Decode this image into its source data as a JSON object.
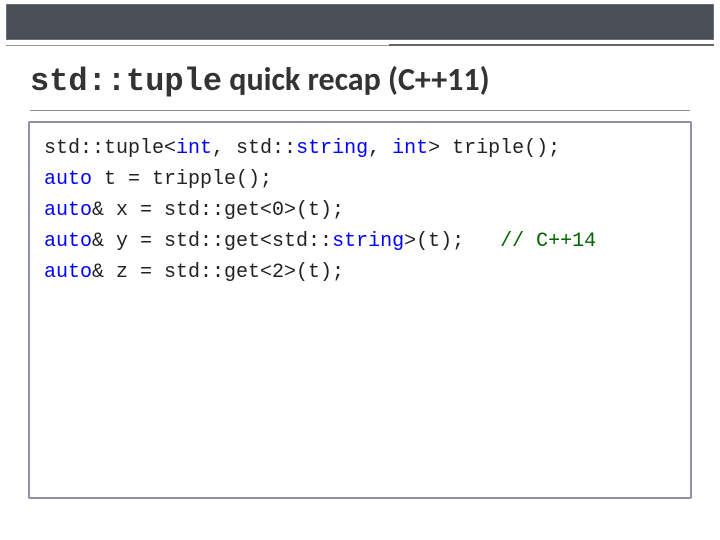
{
  "title": {
    "mono": "std::tuple",
    "rest": " quick recap (C++11)"
  },
  "code": {
    "l1": {
      "a": "std::tuple<",
      "b": "int",
      "c": ", std::",
      "d": "string",
      "e": ", ",
      "f": "int",
      "g": "> triple();"
    },
    "l2": "",
    "l3": {
      "a": "auto",
      "b": " t = tripple();"
    },
    "l4": "",
    "l5": {
      "a": "auto",
      "b": "& x = std::get<0>(t);"
    },
    "l6": {
      "a": "auto",
      "b": "& y = std::get<std::",
      "c": "string",
      "d": ">(t);   ",
      "e": "// C++14"
    },
    "l7": {
      "a": "auto",
      "b": "& z = std::get<2>(t);"
    }
  }
}
